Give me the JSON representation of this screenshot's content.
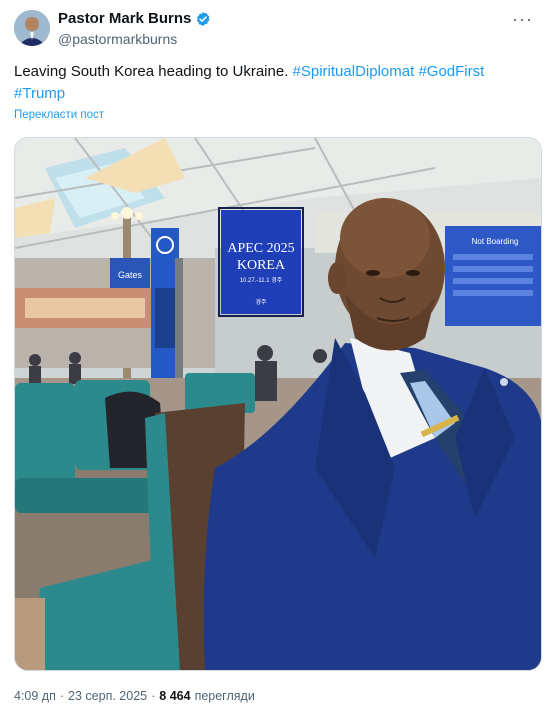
{
  "author": {
    "display_name": "Pastor Mark Burns",
    "handle": "@pastormarkburns",
    "avatar_icon": "avatar-photo",
    "verified_icon": "verified-badge-icon",
    "verified_color": "#1d9bf0"
  },
  "more_icon": "more-options-icon",
  "more_label": "···",
  "tweet": {
    "text_plain": "Leaving South Korea heading to Ukraine. ",
    "hashtags": [
      "#SpiritualDiplomat",
      "#GodFirst",
      "#Trump"
    ],
    "translate_label": "Перекласти пост"
  },
  "media": {
    "sign_line1": "APEC 2025",
    "sign_line2": "KOREA",
    "sign_line3": "10.27.-11.1 경주",
    "sign_footer": "경주",
    "gate_sign": "Gates",
    "right_sign": "Not Boarding"
  },
  "meta": {
    "time": "4:09 дп",
    "separator": "·",
    "date": "23 серп. 2025",
    "views_count": "8 464",
    "views_label": "перегляди"
  },
  "colors": {
    "link": "#1d9bf0",
    "muted": "#536471",
    "text": "#0f1419",
    "suit": "#1f3a8a",
    "seat": "#2d8a8c"
  }
}
